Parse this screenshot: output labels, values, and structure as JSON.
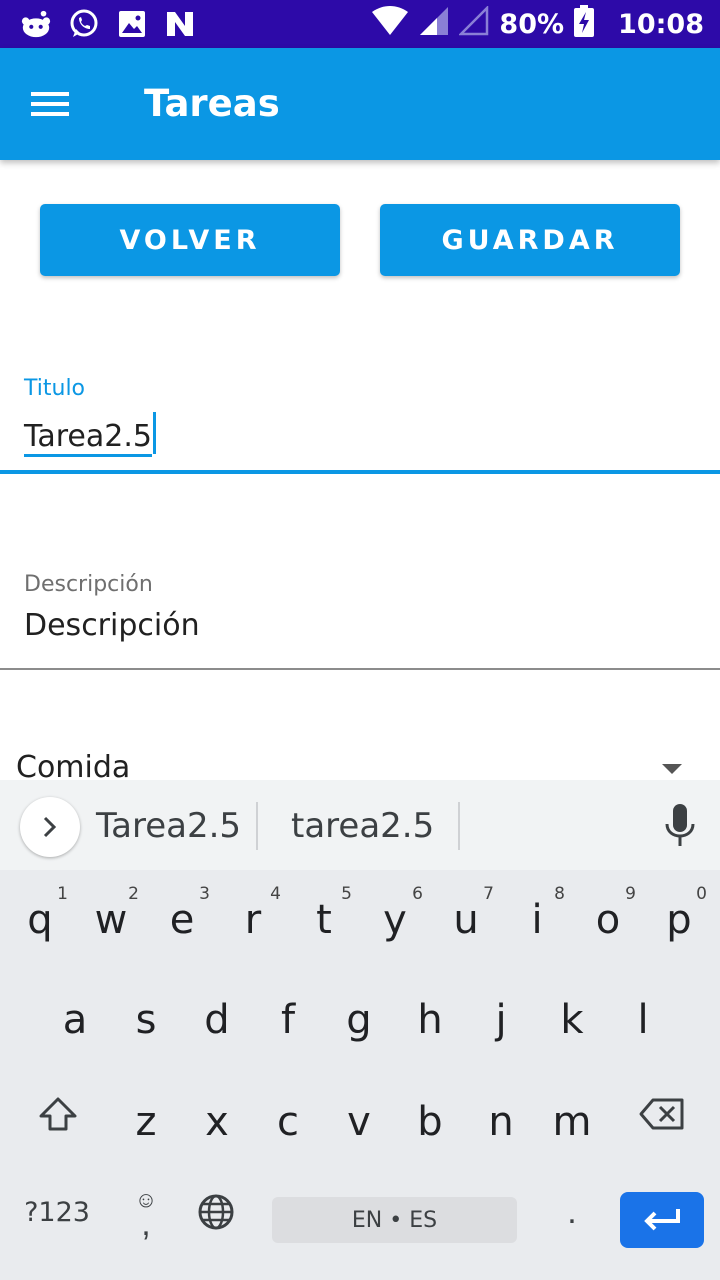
{
  "status_bar": {
    "battery": "80%",
    "time": "10:08",
    "icons": [
      "reddit-icon",
      "whatsapp-icon",
      "gallery-icon",
      "n-app-icon",
      "wifi-icon",
      "signal-icon",
      "signal-empty-icon",
      "battery-charging-icon"
    ]
  },
  "app_bar": {
    "title": "Tareas",
    "menu_icon": "hamburger-menu-icon"
  },
  "actions": {
    "back_label": "VOLVER",
    "save_label": "GUARDAR"
  },
  "form": {
    "title_label": "Titulo",
    "title_value": "Tarea2.5",
    "description_label": "Descripción",
    "description_value": "Descripción",
    "category_value": "Comida"
  },
  "keyboard": {
    "suggestions": [
      "Tarea2.5",
      "tarea2.5"
    ],
    "row1": [
      {
        "key": "q",
        "hint": "1"
      },
      {
        "key": "w",
        "hint": "2"
      },
      {
        "key": "e",
        "hint": "3"
      },
      {
        "key": "r",
        "hint": "4"
      },
      {
        "key": "t",
        "hint": "5"
      },
      {
        "key": "y",
        "hint": "6"
      },
      {
        "key": "u",
        "hint": "7"
      },
      {
        "key": "i",
        "hint": "8"
      },
      {
        "key": "o",
        "hint": "9"
      },
      {
        "key": "p",
        "hint": "0"
      }
    ],
    "row2": [
      "a",
      "s",
      "d",
      "f",
      "g",
      "h",
      "j",
      "k",
      "l"
    ],
    "row3": [
      "z",
      "x",
      "c",
      "v",
      "b",
      "n",
      "m"
    ],
    "symbols_label": "?123",
    "emoji_label": "☺",
    "comma_label": ",",
    "space_label": "EN • ES",
    "period_label": "."
  },
  "colors": {
    "status_bar": "#2d0aa8",
    "accent": "#0b97e4",
    "enter_key": "#1a73e8"
  }
}
